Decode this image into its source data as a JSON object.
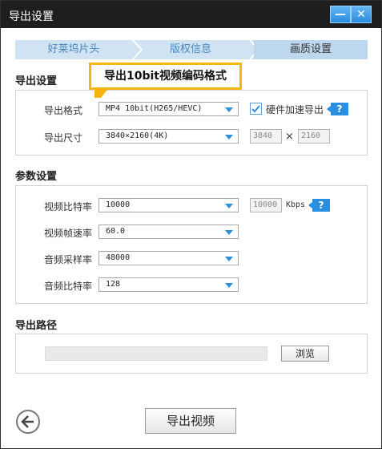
{
  "window": {
    "title": "导出设置",
    "min_glyph": "—",
    "close_glyph": "✕"
  },
  "tabs": [
    {
      "label": "好莱坞片头"
    },
    {
      "label": "版权信息"
    },
    {
      "label": "画质设置"
    }
  ],
  "tooltip": {
    "text": "导出10bit视频编码格式"
  },
  "export_settings": {
    "heading": "导出设置",
    "format_label": "导出格式",
    "format_value": "MP4 10bit(H265/HEVC)",
    "hw_accel_label": "硬件加速导出",
    "hw_accel_checked": true,
    "size_label": "导出尺寸",
    "size_value": "3840×2160(4K)",
    "width": "3840",
    "times": "×",
    "height": "2160"
  },
  "params": {
    "heading": "参数设置",
    "video_bitrate_label": "视频比特率",
    "video_bitrate_value": "10000",
    "video_bitrate_box": "10000",
    "kbps": "Kbps",
    "framerate_label": "视频帧速率",
    "framerate_value": "60.0",
    "audio_samplerate_label": "音频采样率",
    "audio_samplerate_value": "48000",
    "audio_bitrate_label": "音频比特率",
    "audio_bitrate_value": "128"
  },
  "path": {
    "heading": "导出路径",
    "browse_label": "浏览"
  },
  "footer": {
    "export_label": "导出视频"
  },
  "help_glyph": "?",
  "colors": {
    "accent": "#2b8fe0",
    "tooltip_border": "#f4b60f",
    "tab_bg": "#cfe3f3"
  }
}
